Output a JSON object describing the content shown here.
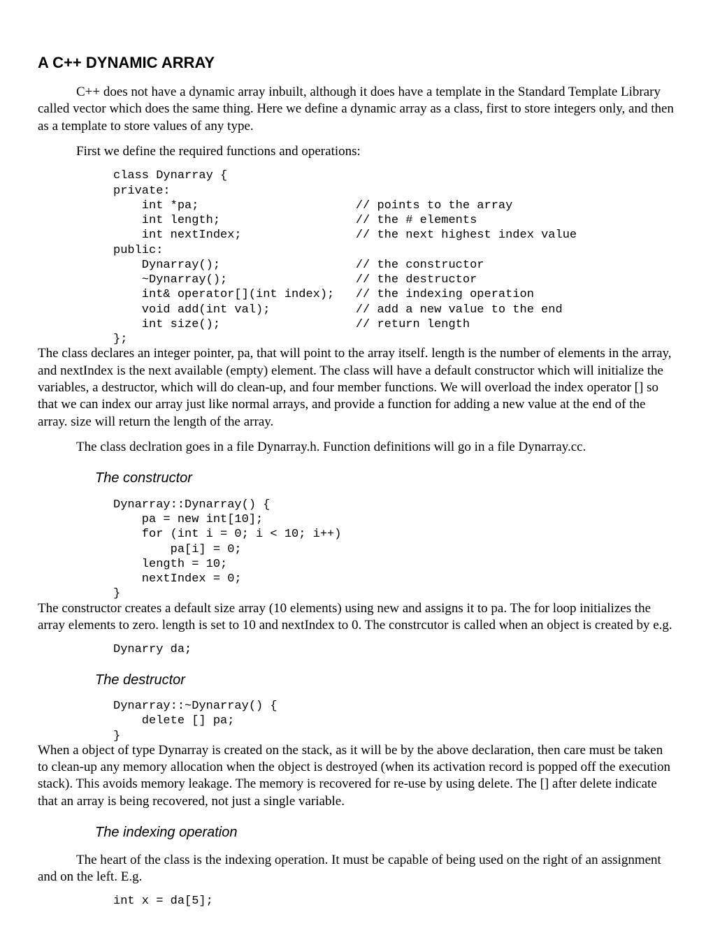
{
  "title": "A C++ DYNAMIC ARRAY",
  "para1": "C++ does not have a dynamic array inbuilt, although it does have a template in the Standard Template Library called vector which does the same thing. Here we define a dynamic array as a class, first to store integers only, and then as a template to store values of any type.",
  "para2": "First we define the required functions and operations:",
  "code1": "class Dynarray {\nprivate:\n    int *pa;                      // points to the array\n    int length;                   // the # elements\n    int nextIndex;                // the next highest index value\npublic:\n    Dynarray();                   // the constructor\n    ~Dynarray();                  // the destructor\n    int& operator[](int index);   // the indexing operation\n    void add(int val);            // add a new value to the end\n    int size();                   // return length\n};",
  "para3": "The class declares an integer pointer, pa, that will point to the array itself. length is the number of elements in the array, and nextIndex is the next available (empty) element. The class will have a default constructor which will initialize the variables, a destructor, which will do clean-up, and four member functions. We will overload the index operator [] so that we can index our array just like normal arrays, and provide a function for adding a new value at the end of the array. size will return the length of the array.",
  "para4": "The class declration goes in a file Dynarray.h. Function definitions will go in a file Dynarray.cc.",
  "h2a": "The constructor",
  "code2": "Dynarray::Dynarray() {\n    pa = new int[10];\n    for (int i = 0; i < 10; i++)\n        pa[i] = 0;\n    length = 10;\n    nextIndex = 0;\n}",
  "para5": "The constructor creates a default size array (10 elements) using new and assigns it to pa. The for loop initializes the array elements to zero. length is set to 10 and nextIndex to 0. The constrcutor is called when an object is created by e.g.",
  "code3": "Dynarry da;",
  "h2b": "The destructor",
  "code4": "Dynarray::~Dynarray() {\n    delete [] pa;\n}",
  "para6": "When a object of type Dynarray is created on the stack, as it will be by the above declaration, then care must be taken to clean-up any memory allocation when the object is destroyed (when its activation record is popped off the execution stack). This avoids memory leakage. The memory is recovered for re-use by using delete. The [] after delete indicate that an array is being recovered, not just a single variable.",
  "h2c": "The indexing operation",
  "para7": "The heart of the class is the indexing operation. It must be capable of being used on the right of an assignment and on the left. E.g.",
  "code5": "int x = da[5];"
}
